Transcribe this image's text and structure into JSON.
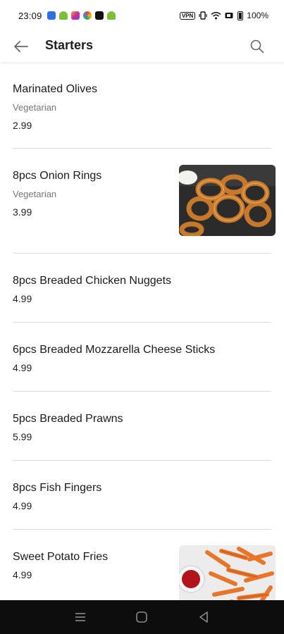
{
  "status_bar": {
    "time": "23:09",
    "vpn": "VPN",
    "battery": "100%",
    "notification_icons": [
      "messenger-icon",
      "android-icon",
      "instagram-icon",
      "camera-icon",
      "app-icon",
      "android-icon"
    ]
  },
  "app_bar": {
    "title": "Starters"
  },
  "menu": {
    "items": [
      {
        "name": "Marinated Olives",
        "tag": "Vegetarian",
        "price": "2.99"
      },
      {
        "name": "8pcs Onion Rings",
        "tag": "Vegetarian",
        "price": "3.99",
        "image": "onion-rings-photo"
      },
      {
        "name": "8pcs Breaded Chicken Nuggets",
        "price": "4.99"
      },
      {
        "name": "6pcs Breaded Mozzarella Cheese Sticks",
        "price": "4.99"
      },
      {
        "name": "5pcs Breaded Prawns",
        "price": "5.99"
      },
      {
        "name": "8pcs Fish Fingers",
        "price": "4.99"
      },
      {
        "name": "Sweet Potato Fries",
        "price": "4.99",
        "image": "sweet-potato-fries-photo"
      }
    ]
  },
  "colors": {
    "divider": "#dcdcdc",
    "nav_bar": "#0d0d0d",
    "tag_text": "#777777"
  }
}
